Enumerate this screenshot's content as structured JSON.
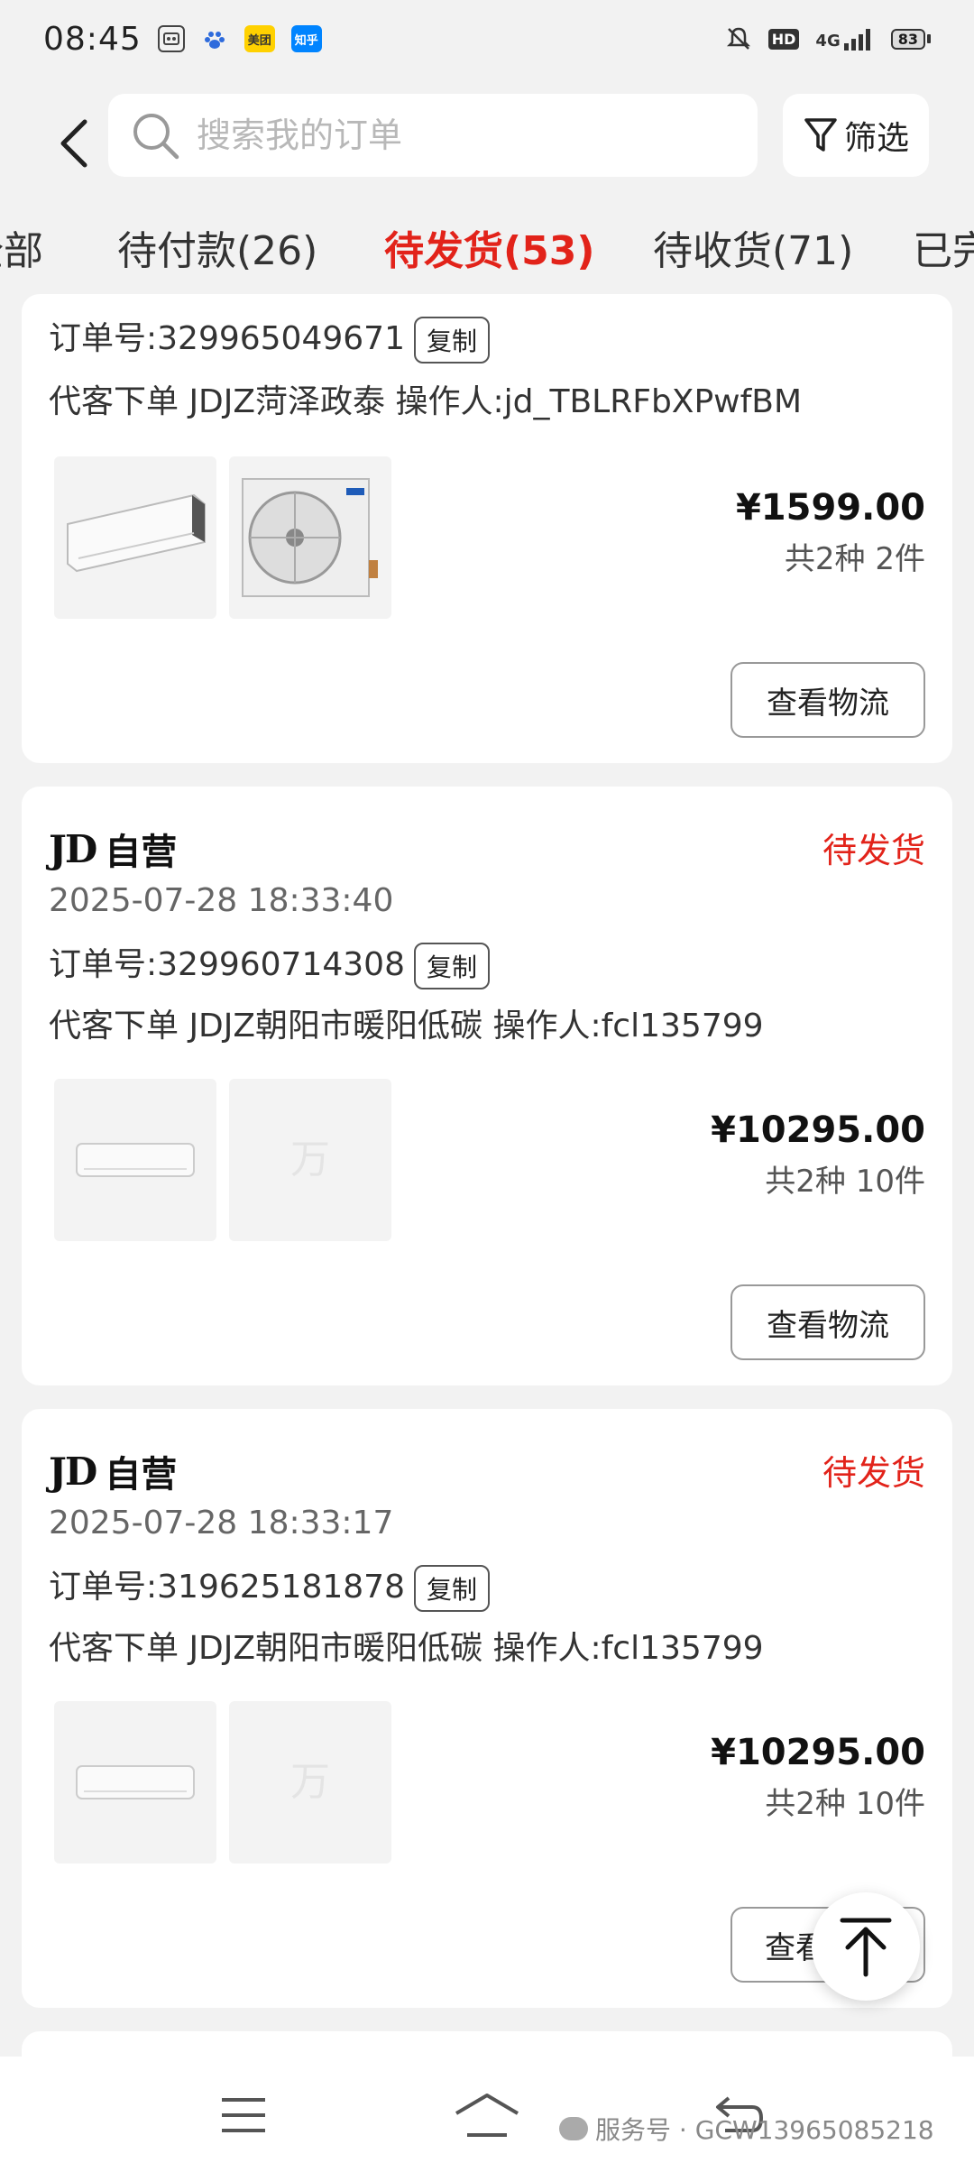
{
  "status_bar": {
    "time": "08:45",
    "app_badges": [
      "美团",
      "知乎"
    ],
    "network": "4G",
    "hd": "HD",
    "battery": "83"
  },
  "header": {
    "search_placeholder": "搜索我的订单",
    "filter_label": "筛选"
  },
  "tabs": [
    {
      "label": "全部",
      "active": false
    },
    {
      "label": "待付款(26)",
      "active": false
    },
    {
      "label": "待发货(53)",
      "active": true
    },
    {
      "label": "待收货(71)",
      "active": false
    },
    {
      "label": "已完",
      "active": false
    }
  ],
  "orders": [
    {
      "order_no": "订单号:329965049671",
      "copy_label": "复制",
      "agent_line": "代客下单  JDJZ菏泽政泰  操作人:jd_TBLRFbXPwfBM",
      "price": "¥1599.00",
      "quantity": "共2种 2件",
      "logistics_label": "查看物流"
    },
    {
      "shop_logo": "JD",
      "shop_name": "自营",
      "status": "待发货",
      "date": "2025-07-28  18:33:40",
      "order_no": "订单号:329960714308",
      "copy_label": "复制",
      "agent_line": "代客下单  JDJZ朝阳市暖阳低碳  操作人:fcl135799",
      "price": "¥10295.00",
      "quantity": "共2种 10件",
      "logistics_label": "查看物流"
    },
    {
      "shop_logo": "JD",
      "shop_name": "自营",
      "status": "待发货",
      "date": "2025-07-28  18:33:17",
      "order_no": "订单号:319625181878",
      "copy_label": "复制",
      "agent_line": "代客下单  JDJZ朝阳市暖阳低碳  操作人:fcl135799",
      "price": "¥10295.00",
      "quantity": "共2种 10件",
      "logistics_label": "查看"
    }
  ],
  "watermark": {
    "text": "服务号 · GCW13965085218"
  },
  "colors": {
    "accent": "#e2231a",
    "background": "#f2f2f2"
  }
}
